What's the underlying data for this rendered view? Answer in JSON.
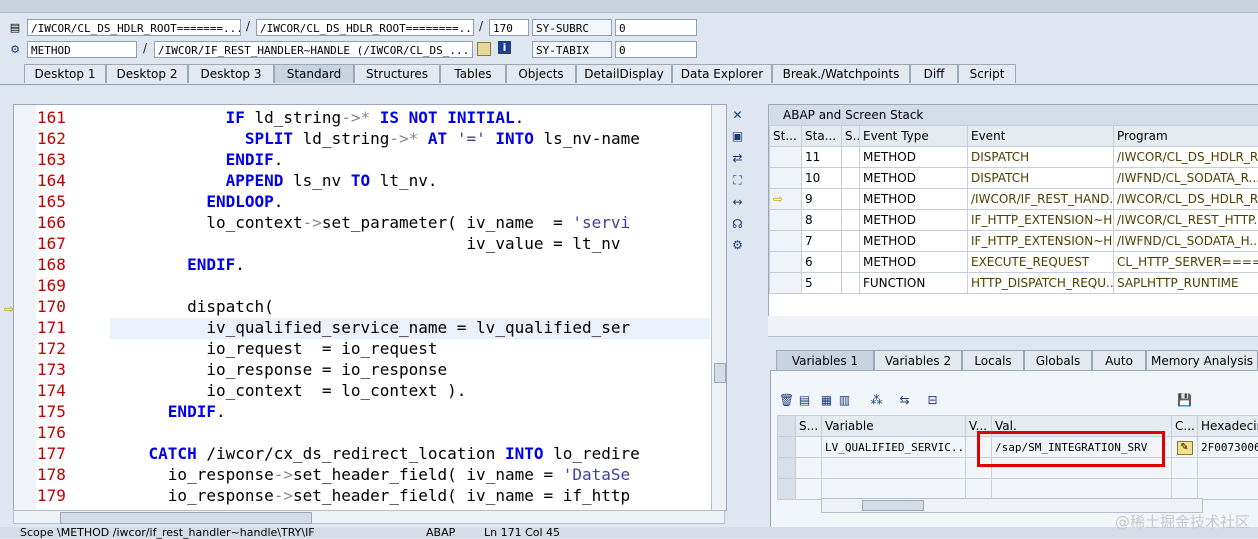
{
  "header": {
    "row1": {
      "program_1": "/IWCOR/CL_DS_HDLR_ROOT=======...",
      "program_2": "/IWCOR/CL_DS_HDLR_ROOT========...",
      "line": "170",
      "sysvar": "SY-SUBRC",
      "sysvar_value": "0"
    },
    "row2": {
      "event_type": "METHOD",
      "event": "/IWCOR/IF_REST_HANDLER~HANDLE (/IWCOR/CL_DS_...",
      "sysvar": "SY-TABIX",
      "sysvar_value": "0"
    }
  },
  "tabs": [
    "Desktop 1",
    "Desktop 2",
    "Desktop 3",
    "Standard",
    "Structures",
    "Tables",
    "Objects",
    "DetailDisplay",
    "Data Explorer",
    "Break./Watchpoints",
    "Diff",
    "Script"
  ],
  "active_tab": "Standard",
  "code": {
    "lines": [
      {
        "n": "161",
        "t": "            IF ld_string->* IS NOT INITIAL."
      },
      {
        "n": "162",
        "t": "              SPLIT ld_string->* AT '=' INTO ls_nv-name"
      },
      {
        "n": "163",
        "t": "            ENDIF."
      },
      {
        "n": "164",
        "t": "            APPEND ls_nv TO lt_nv."
      },
      {
        "n": "165",
        "t": "          ENDLOOP."
      },
      {
        "n": "166",
        "t": "          lo_context->set_parameter( iv_name  = 'servi"
      },
      {
        "n": "167",
        "t": "                                     iv_value = lt_nv"
      },
      {
        "n": "168",
        "t": "        ENDIF."
      },
      {
        "n": "169",
        "t": ""
      },
      {
        "n": "170",
        "t": "        dispatch("
      },
      {
        "n": "171",
        "t": "          iv_qualified_service_name = lv_qualified_ser"
      },
      {
        "n": "172",
        "t": "          io_request  = io_request"
      },
      {
        "n": "173",
        "t": "          io_response = io_response"
      },
      {
        "n": "174",
        "t": "          io_context  = lo_context )."
      },
      {
        "n": "175",
        "t": "      ENDIF."
      },
      {
        "n": "176",
        "t": ""
      },
      {
        "n": "177",
        "t": "    CATCH /iwcor/cx_ds_redirect_location INTO lo_redire"
      },
      {
        "n": "178",
        "t": "      io_response->set_header_field( iv_name = 'DataSe"
      },
      {
        "n": "179",
        "t": "      io_response->set_header_field( iv_name = if_http"
      }
    ]
  },
  "stack_panel": {
    "title": "ABAP and Screen Stack",
    "columns": [
      "St...",
      "Sta...",
      "S...",
      "Event Type",
      "Event",
      "Program"
    ],
    "rows": [
      {
        "level": "11",
        "type": "METHOD",
        "event": "DISPATCH",
        "program": "/IWCOR/CL_DS_HDLR_R..."
      },
      {
        "level": "10",
        "type": "METHOD",
        "event": "DISPATCH",
        "program": "/IWFND/CL_SODATA_R..."
      },
      {
        "level": "9",
        "type": "METHOD",
        "event": "/IWCOR/IF_REST_HAND...",
        "program": "/IWCOR/CL_DS_HDLR_R..."
      },
      {
        "level": "8",
        "type": "METHOD",
        "event": "IF_HTTP_EXTENSION~H...",
        "program": "/IWCOR/CL_REST_HTTP..."
      },
      {
        "level": "7",
        "type": "METHOD",
        "event": "IF_HTTP_EXTENSION~H...",
        "program": "/IWFND/CL_SODATA_H..."
      },
      {
        "level": "6",
        "type": "METHOD",
        "event": "EXECUTE_REQUEST",
        "program": "CL_HTTP_SERVER====..."
      },
      {
        "level": "5",
        "type": "FUNCTION",
        "event": "HTTP_DISPATCH_REQU...",
        "program": "SAPLHTTP_RUNTIME"
      }
    ]
  },
  "var_tabs": [
    "Variables 1",
    "Variables 2",
    "Locals",
    "Globals",
    "Auto",
    "Memory Analysis"
  ],
  "active_var_tab": "Variables 1",
  "variables": {
    "columns": [
      "S...",
      "Variable",
      "V...",
      "Val.",
      "C...",
      "Hexadecim"
    ],
    "rows": [
      {
        "name": "LV_QUALIFIED_SERVIC...",
        "value": "/sap/SM_INTEGRATION_SRV",
        "hex": "2F0073006"
      }
    ]
  },
  "status": {
    "scope": "Scope \\METHOD /iwcor/if_rest_handler~handle\\TRY\\IF",
    "lang": "ABAP",
    "position": "Ln 171 Col 45"
  },
  "watermark": "@稀土掘金技术社区",
  "colors": {
    "keyword": "#0000ee",
    "line_number": "#c00000",
    "highlight_box": "#e00000"
  }
}
